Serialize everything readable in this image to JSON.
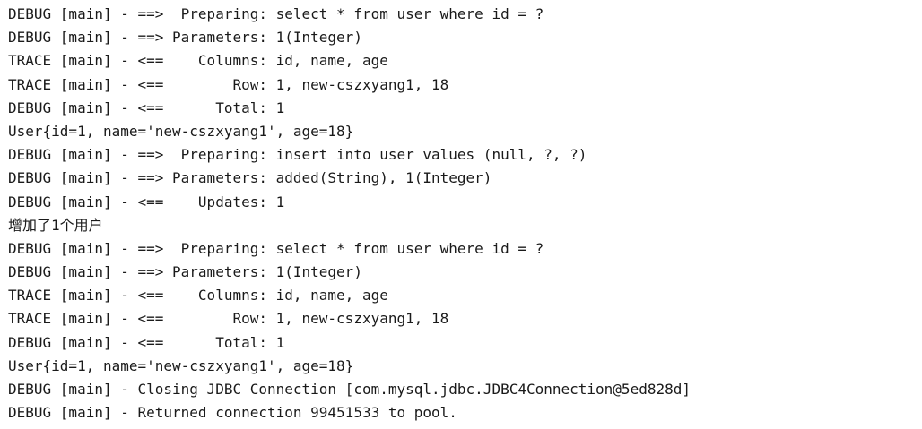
{
  "console": {
    "lines": [
      "DEBUG [main] - ==>  Preparing: select * from user where id = ?",
      "DEBUG [main] - ==> Parameters: 1(Integer)",
      "TRACE [main] - <==    Columns: id, name, age",
      "TRACE [main] - <==        Row: 1, new-cszxyang1, 18",
      "DEBUG [main] - <==      Total: 1",
      "User{id=1, name='new-cszxyang1', age=18}",
      "DEBUG [main] - ==>  Preparing: insert into user values (null, ?, ?)",
      "DEBUG [main] - ==> Parameters: added(String), 1(Integer)",
      "DEBUG [main] - <==    Updates: 1",
      "增加了1个用户",
      "DEBUG [main] - ==>  Preparing: select * from user where id = ?",
      "DEBUG [main] - ==> Parameters: 1(Integer)",
      "TRACE [main] - <==    Columns: id, name, age",
      "TRACE [main] - <==        Row: 1, new-cszxyang1, 18",
      "DEBUG [main] - <==      Total: 1",
      "User{id=1, name='new-cszxyang1', age=18}",
      "DEBUG [main] - Closing JDBC Connection [com.mysql.jdbc.JDBC4Connection@5ed828d]",
      "DEBUG [main] - Returned connection 99451533 to pool."
    ]
  }
}
